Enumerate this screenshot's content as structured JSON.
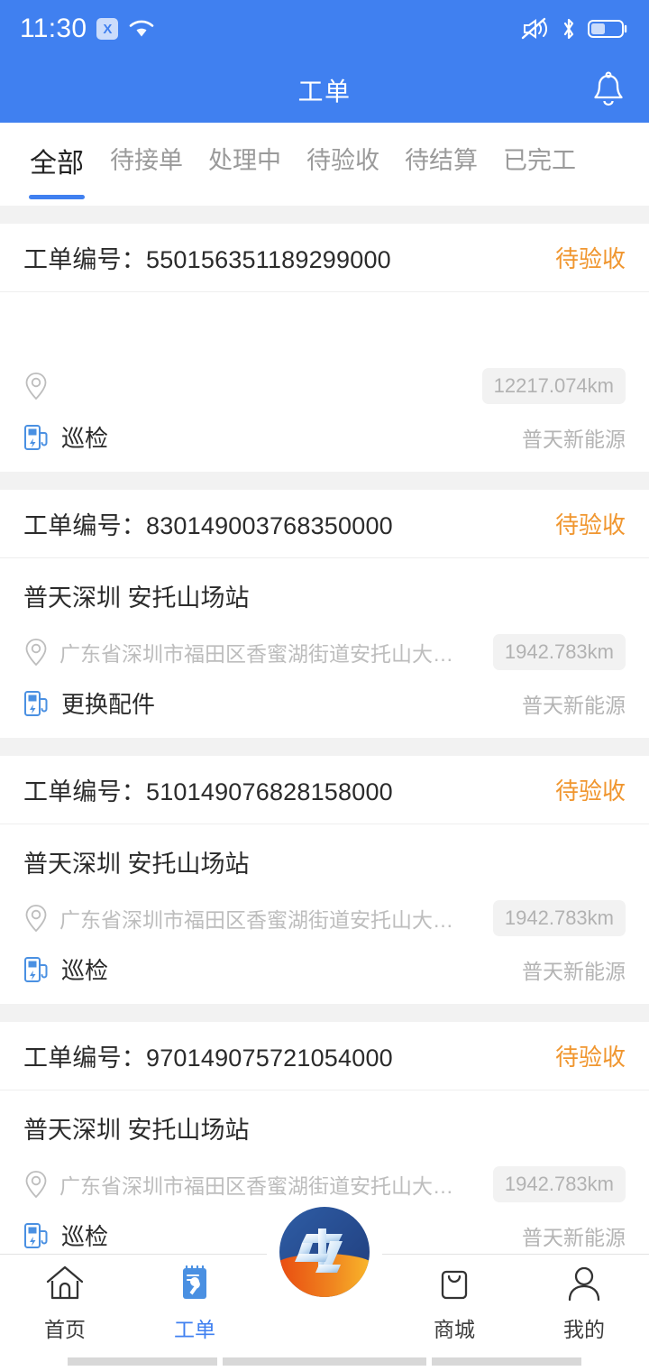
{
  "statusbar": {
    "time": "11:30",
    "x_badge": "X",
    "icons": [
      "wifi-icon",
      "mute-icon",
      "bluetooth-icon",
      "battery-icon"
    ],
    "battery_level": "45"
  },
  "header": {
    "title": "工单",
    "bell_icon": "bell-icon",
    "background": "#4080f0"
  },
  "tabs": [
    {
      "label": "全部",
      "active": true
    },
    {
      "label": "待接单",
      "active": false
    },
    {
      "label": "处理中",
      "active": false
    },
    {
      "label": "待验收",
      "active": false
    },
    {
      "label": "待结算",
      "active": false
    },
    {
      "label": "已完工",
      "active": false
    }
  ],
  "colors": {
    "accent": "#4080f0",
    "status_pending": "#f0962f",
    "page_bg": "#f2f2f2",
    "muted_text": "#b4b4b4"
  },
  "list": {
    "order_label": "工单编号：",
    "cards": [
      {
        "order_no": "550156351189299000",
        "status": "待验收",
        "station": "",
        "address": "",
        "distance": "12217.074km",
        "work_type": "巡检",
        "company": "普天新能源"
      },
      {
        "order_no": "830149003768350000",
        "status": "待验收",
        "station": "普天深圳 安托山场站",
        "address": "广东省深圳市福田区香蜜湖街道安托山大…",
        "distance": "1942.783km",
        "work_type": "更换配件",
        "company": "普天新能源"
      },
      {
        "order_no": "510149076828158000",
        "status": "待验收",
        "station": "普天深圳 安托山场站",
        "address": "广东省深圳市福田区香蜜湖街道安托山大…",
        "distance": "1942.783km",
        "work_type": "巡检",
        "company": "普天新能源"
      },
      {
        "order_no": "970149075721054000",
        "status": "待验收",
        "station": "普天深圳 安托山场站",
        "address": "广东省深圳市福田区香蜜湖街道安托山大…",
        "distance": "1942.783km",
        "work_type": "巡检",
        "company": "普天新能源"
      }
    ]
  },
  "bottomnav": {
    "items": [
      {
        "label": "首页",
        "icon": "home-icon",
        "active": false
      },
      {
        "label": "工单",
        "icon": "clipboard-wrench-icon",
        "active": true
      },
      {
        "label": "商城",
        "icon": "shopping-bag-icon",
        "active": false
      },
      {
        "label": "我的",
        "icon": "person-icon",
        "active": false
      }
    ],
    "center_logo": "company-logo-icon"
  }
}
